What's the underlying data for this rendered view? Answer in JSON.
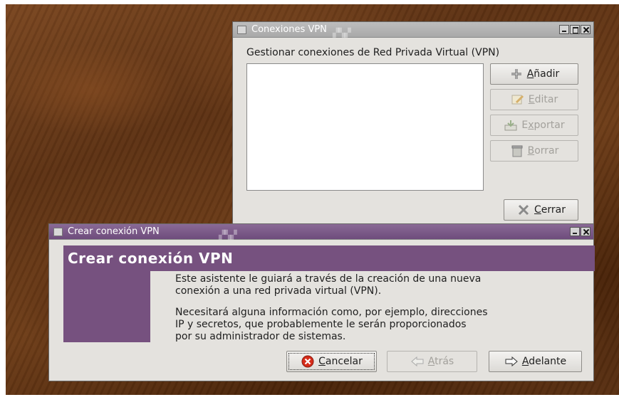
{
  "vpn_window": {
    "title": "Conexiones VPN",
    "subtitle": "Gestionar conexiones de Red Privada Virtual (VPN)",
    "buttons": {
      "add": {
        "mnemonic": "A",
        "rest": "ñadir"
      },
      "edit": {
        "mnemonic": "E",
        "rest": "ditar"
      },
      "export": {
        "pre": "E",
        "mnemonic": "x",
        "rest": "portar"
      },
      "delete": {
        "mnemonic": "B",
        "rest": "orrar"
      },
      "close": {
        "mnemonic": "C",
        "rest": "errar"
      }
    }
  },
  "wizard_window": {
    "title": "Crear conexión VPN",
    "header": "Crear conexión VPN",
    "paragraph1_line1": "Este asistente le guiará a través de la creación de una nueva",
    "paragraph1_line2": "conexión a una red privada virtual (VPN).",
    "paragraph2_line1": "Necesitará alguna información como, por ejemplo, direcciones",
    "paragraph2_line2": "IP y secretos, que probablemente le serán proporcionados",
    "paragraph2_line3": "por su administrador de sistemas.",
    "buttons": {
      "cancel": {
        "mnemonic": "C",
        "rest": "ancelar"
      },
      "back": {
        "mnemonic": "A",
        "rest": "trás"
      },
      "forward": {
        "mnemonic": "A",
        "rest": "delante"
      }
    }
  },
  "colors": {
    "wizard_accent": "#76517f",
    "window_bg": "#e4e2de"
  }
}
